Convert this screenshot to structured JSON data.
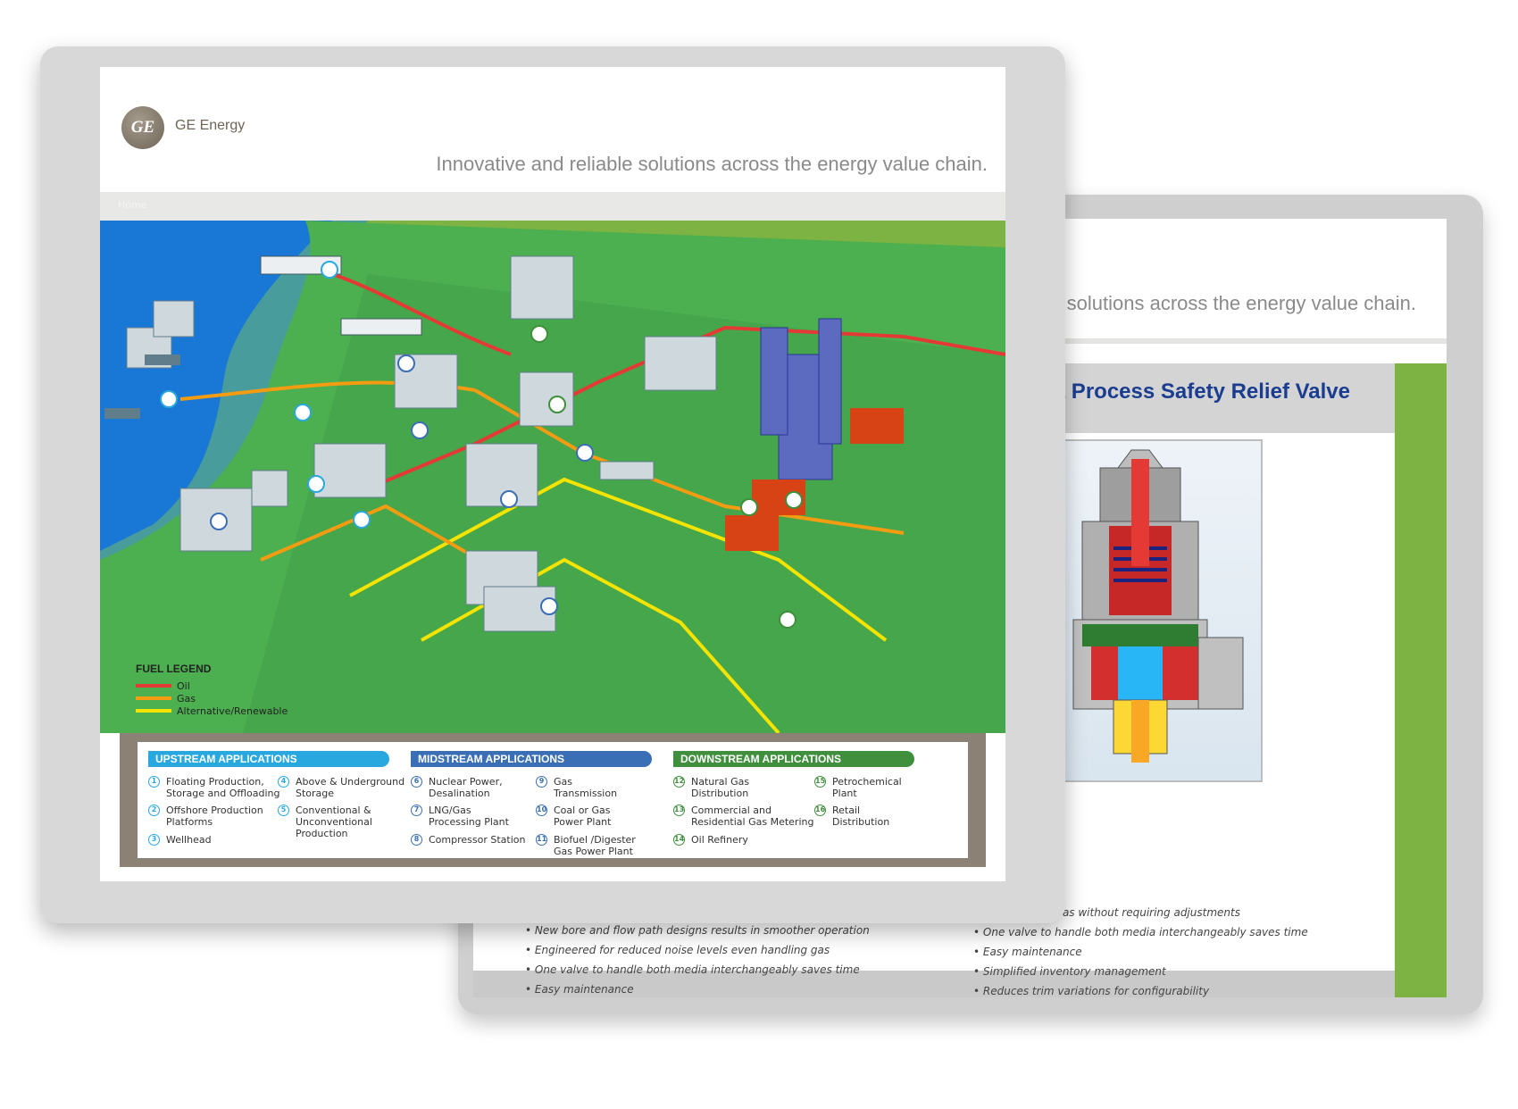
{
  "back_window": {
    "tagline": "solutions across the energy value chain.",
    "title": "Media Process Safety Relief Valve",
    "bullets_left": [
      "New bore and flow path designs results in smoother operation",
      "Engineered for reduced noise levels even handling gas",
      "One valve to handle both media interchangeably saves time",
      "Easy maintenance"
    ],
    "bullets_right": [
      "with liquid and gas without requiring adjustments",
      "One valve to handle both media interchangeably saves time",
      "Easy maintenance",
      "Simplified inventory management",
      "Reduces trim variations for configurability"
    ]
  },
  "front_window": {
    "logo_text": "GE",
    "brand": "GE Energy",
    "tagline": "Innovative and reliable solutions across the energy value chain.",
    "breadcrumb": "Home",
    "legend": {
      "title": "FUEL LEGEND",
      "items": [
        {
          "label": "Oil",
          "color": "#e53935"
        },
        {
          "label": "Gas",
          "color": "#f39c12"
        },
        {
          "label": "Alternative/Renewable",
          "color": "#f4e400"
        }
      ]
    },
    "map_markers": [
      "1",
      "2",
      "3",
      "4",
      "5",
      "6",
      "7",
      "8",
      "9",
      "10",
      "11",
      "12",
      "13",
      "14",
      "15",
      "16"
    ],
    "applications": {
      "upstream": {
        "title": "UPSTREAM APPLICATIONS",
        "color": "#29a8e0",
        "items": [
          {
            "num": "1",
            "label": "Floating Production,\nStorage and Offloading"
          },
          {
            "num": "2",
            "label": "Offshore Production\nPlatforms"
          },
          {
            "num": "3",
            "label": "Wellhead"
          },
          {
            "num": "4",
            "label": "Above & Underground\nStorage"
          },
          {
            "num": "5",
            "label": "Conventional &\nUnconventional\nProduction"
          }
        ]
      },
      "midstream": {
        "title": "MIDSTREAM APPLICATIONS",
        "color": "#3a6fb5",
        "items": [
          {
            "num": "6",
            "label": "Nuclear Power,\nDesalination"
          },
          {
            "num": "7",
            "label": "LNG/Gas\nProcessing Plant"
          },
          {
            "num": "8",
            "label": "Compressor Station"
          },
          {
            "num": "9",
            "label": "Gas\nTransmission"
          },
          {
            "num": "10",
            "label": "Coal or Gas\nPower Plant"
          },
          {
            "num": "11",
            "label": "Biofuel /Digester\nGas Power Plant"
          }
        ]
      },
      "downstream": {
        "title": "DOWNSTREAM APPLICATIONS",
        "color": "#3f8f3c",
        "items": [
          {
            "num": "12",
            "label": "Natural Gas\nDistribution"
          },
          {
            "num": "13",
            "label": "Commercial and\nResidential Gas Metering"
          },
          {
            "num": "14",
            "label": "Oil Refinery"
          },
          {
            "num": "15",
            "label": "Petrochemical\nPlant"
          },
          {
            "num": "16",
            "label": "Retail\nDistribution"
          }
        ]
      }
    }
  }
}
